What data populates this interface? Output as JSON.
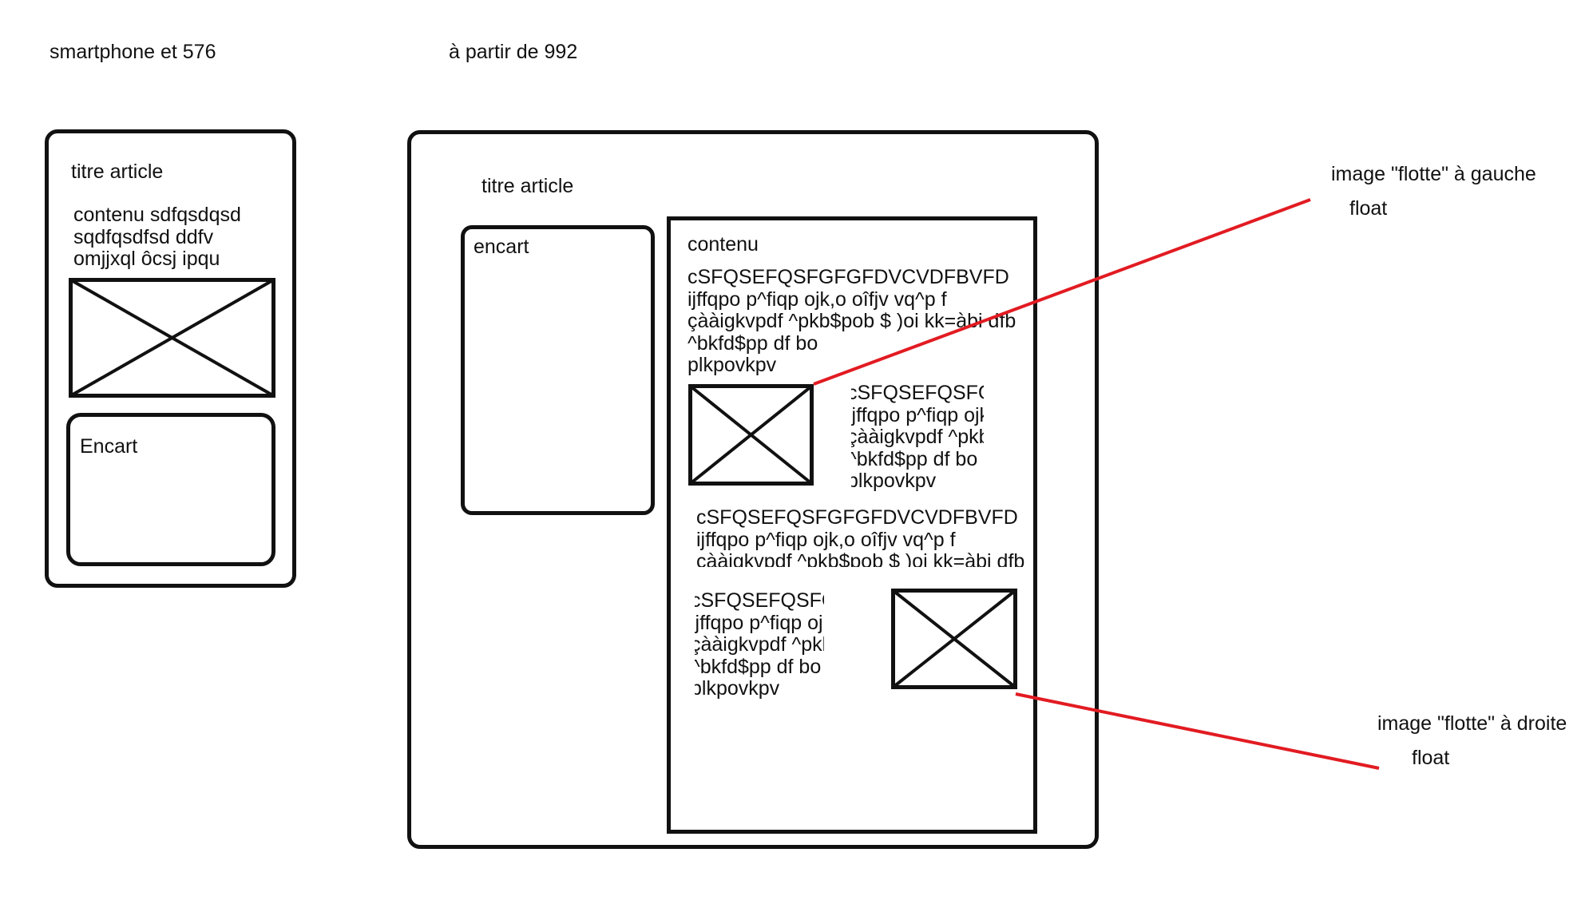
{
  "headings": {
    "mobile": "smartphone et 576",
    "desktop": "à partir de 992"
  },
  "mobile": {
    "title": "titre article",
    "content_lines": [
      "contenu sdfqsdqsd",
      "sqdfqsdfsd ddfv",
      "omjjxql ôcsj ipqu"
    ],
    "encart": "Encart"
  },
  "desktop": {
    "title": "titre article",
    "encart": "encart",
    "content_heading": "contenu",
    "text_lines": [
      "cSFQSEFQSFGFGFDVCVDFBVFD",
      "ijffqpo p^fiqp ojk,o oîfjv vq^p f",
      "çààigkvpdf ^pkb$pob $  )oi kk=àbi dfb",
      "^bkfd$pp df bo",
      "plkpovkpv"
    ],
    "float_left_text": [
      "cSFQSEFQSFGFGFDVCVDFBVFD",
      "ijffqpo p^fiqp ojk,o oîfjv vq^p f",
      "çààigkvpdf ^pkb$pob $  )oi kk=àbi dfb",
      "^bkfd$pp df bo",
      "plkpovkpv"
    ],
    "middle_text": [
      "cSFQSEFQSFGFGFDVCVDFBVFD",
      "ijffqpo p^fiqp ojk,o oîfjv vq^p f",
      "çààigkvpdf ^pkb$pob $  )oi kk=àbi dfb"
    ],
    "float_right_text": [
      "cSFQSEFQSFGFGFDVCVDFBVFD",
      "ijffqpo p^fiqp ojk,o oîfjv vq^p f",
      "çààigkvpdf ^pkb$pob $  )oi kk=àbi dfb",
      "^bkfd$pp df bo",
      "plkpovkpv"
    ]
  },
  "annotations": {
    "left": {
      "line1": "image \"flotte\" à gauche",
      "line2": "float"
    },
    "right": {
      "line1": "image \"flotte\" à droite",
      "line2": "float"
    }
  },
  "colors": {
    "stroke": "#111111",
    "annotation_line": "#e21b22",
    "background": "#ffffff"
  }
}
